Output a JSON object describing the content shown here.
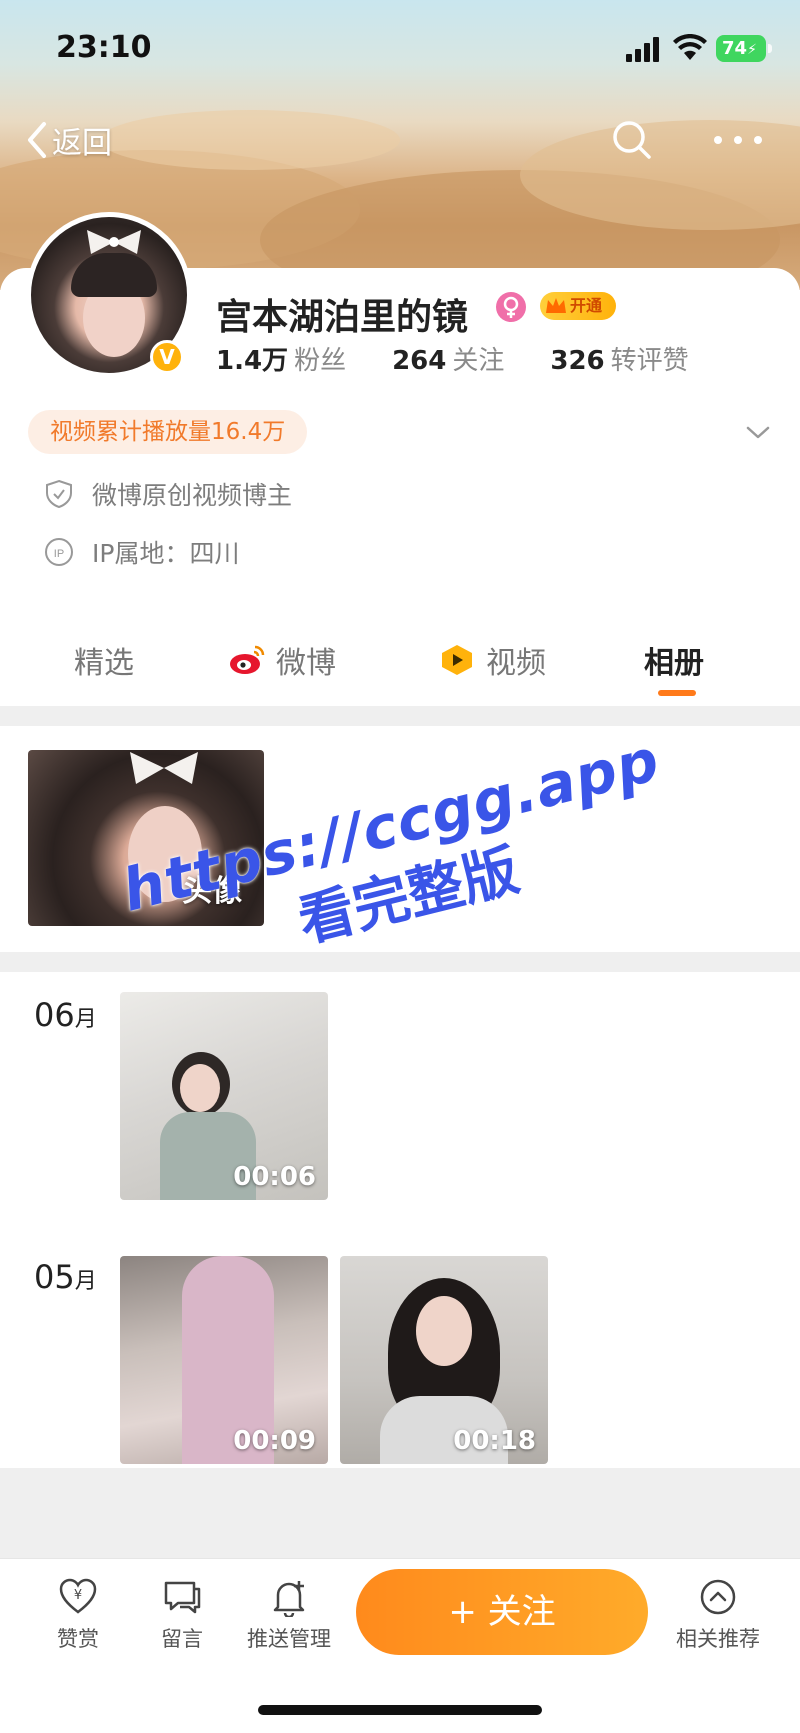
{
  "status_bar": {
    "time": "23:10",
    "battery": "74"
  },
  "nav": {
    "back_label": "返回"
  },
  "profile": {
    "username": "宫本湖泊里的镜",
    "vip_label": "开通",
    "verified_badge": "V",
    "stats": [
      {
        "num": "1.4万",
        "label": "粉丝"
      },
      {
        "num": "264",
        "label": "关注"
      },
      {
        "num": "326",
        "label": "转评赞"
      }
    ],
    "play_count": "视频累计播放量16.4万",
    "certification": "微博原创视频博主",
    "ip_location": "IP属地：四川"
  },
  "tabs": [
    {
      "label": "精选",
      "active": false
    },
    {
      "label": "微博",
      "active": false,
      "icon": "weibo-icon"
    },
    {
      "label": "视频",
      "active": false,
      "icon": "video-icon"
    },
    {
      "label": "相册",
      "active": true
    }
  ],
  "album": {
    "avatar_caption": "头像",
    "groups": [
      {
        "month_num": "06",
        "month_unit": "月",
        "items": [
          {
            "duration": "00:06"
          }
        ]
      },
      {
        "month_num": "05",
        "month_unit": "月",
        "items": [
          {
            "duration": "00:09"
          },
          {
            "duration": "00:18"
          }
        ]
      }
    ]
  },
  "watermark": {
    "url": "https://ccgg.app",
    "text": "看完整版"
  },
  "bottom_bar": {
    "reward": "赞赏",
    "message": "留言",
    "push_manage": "推送管理",
    "follow": "+ 关注",
    "related": "相关推荐"
  },
  "colors": {
    "accent": "#ff7a1a",
    "pill_bg": "#fdeee4",
    "pill_text": "#f17a2b",
    "follow_gradient_start": "#ff8a1c",
    "follow_gradient_end": "#ffab2a"
  }
}
